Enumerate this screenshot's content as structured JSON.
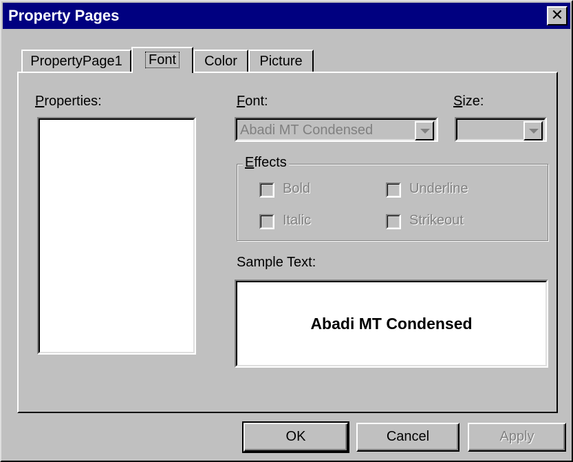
{
  "window": {
    "title": "Property Pages",
    "close_glyph": "✕"
  },
  "tabs": [
    {
      "label": "PropertyPage1"
    },
    {
      "label": "Font"
    },
    {
      "label": "Color"
    },
    {
      "label": "Picture"
    }
  ],
  "active_tab": "Font",
  "font_page": {
    "properties_label_u": "P",
    "properties_label_rest": "roperties:",
    "font_label_u": "F",
    "font_label_rest": "ont:",
    "size_label_u": "S",
    "size_label_rest": "ize:",
    "font_value": "Abadi MT Condensed",
    "size_value": "",
    "effects_label_u": "E",
    "effects_label_rest": "ffects",
    "effects": {
      "bold": "Bold",
      "italic": "Italic",
      "underline": "Underline",
      "strikeout": "Strikeout"
    },
    "sample_label": "Sample Text:",
    "sample_text": "Abadi MT Condensed"
  },
  "buttons": {
    "ok": "OK",
    "cancel": "Cancel",
    "apply": "Apply"
  },
  "colors": {
    "title_bar": "#000080",
    "face": "#c0c0c0",
    "disabled_text": "#808080"
  }
}
